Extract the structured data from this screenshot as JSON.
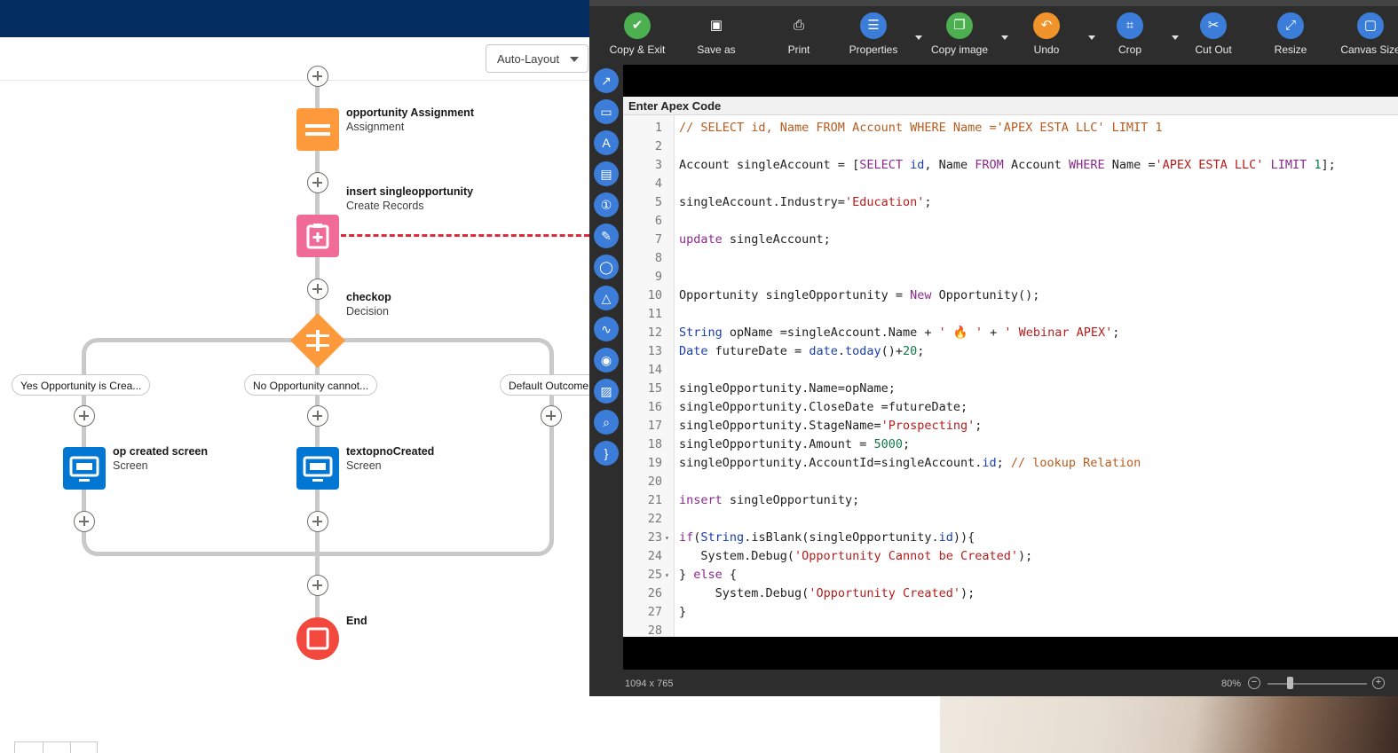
{
  "flow": {
    "auto_layout_label": "Auto-Layout",
    "nodes": {
      "assignment": {
        "title": "opportunity Assignment",
        "subtitle": "Assignment",
        "color": "#ff9a3c"
      },
      "create": {
        "title": "insert singleopportunity",
        "subtitle": "Create Records",
        "color": "#f06b97"
      },
      "decision": {
        "title": "checkop",
        "subtitle": "Decision",
        "color": "#ff9a3c"
      },
      "screen_yes": {
        "title": "op created screen",
        "subtitle": "Screen",
        "color": "#0176d3"
      },
      "screen_no": {
        "title": "textopnoCreated",
        "subtitle": "Screen",
        "color": "#0176d3"
      },
      "end": {
        "title": "End",
        "color": "#f2483d"
      }
    },
    "outcomes": {
      "yes": "Yes Opportunity is Crea...",
      "no": "No Opportunity cannot...",
      "default": "Default Outcome"
    },
    "fault_path_color": "#e0293b"
  },
  "editor": {
    "toolbar": [
      {
        "label": "Copy & Exit",
        "icon": "save-icon",
        "color": "#4caf50",
        "dropdown": false
      },
      {
        "label": "Save as",
        "icon": "floppy-icon",
        "color": "#2d2d2d",
        "dropdown": false
      },
      {
        "label": "Print",
        "icon": "printer-icon",
        "color": "#2d2d2d",
        "dropdown": false
      },
      {
        "label": "Properties",
        "icon": "list-icon",
        "color": "#3b7dd8",
        "dropdown": true
      },
      {
        "label": "Copy image",
        "icon": "copy-image-icon",
        "color": "#4caf50",
        "dropdown": true
      },
      {
        "label": "Undo",
        "icon": "undo-icon",
        "color": "#f0932b",
        "dropdown": true
      },
      {
        "label": "Crop",
        "icon": "crop-icon",
        "color": "#3b7dd8",
        "dropdown": true
      },
      {
        "label": "Cut Out",
        "icon": "cut-out-icon",
        "color": "#3b7dd8",
        "dropdown": false
      },
      {
        "label": "Resize",
        "icon": "resize-icon",
        "color": "#3b7dd8",
        "dropdown": false
      },
      {
        "label": "Canvas Size",
        "icon": "canvas-size-icon",
        "color": "#3b7dd8",
        "dropdown": false
      }
    ],
    "side_tools": [
      "arrow-icon",
      "rectangle-icon",
      "text-icon",
      "callout-icon",
      "step-icon",
      "highlighter-icon",
      "ellipse-icon",
      "blur-icon",
      "freehand-icon",
      "fill-icon",
      "image-icon",
      "magnifier-icon",
      "bracket-icon"
    ],
    "code_title": "Enter Apex Code",
    "code_lines": [
      {
        "n": "1",
        "fold": false,
        "tokens": [
          {
            "t": "// SELECT id, Name FROM Account WHERE Name ='APEX ESTA LLC' LIMIT 1",
            "c": "comment"
          }
        ]
      },
      {
        "n": "2",
        "fold": false,
        "tokens": []
      },
      {
        "n": "3",
        "fold": false,
        "tokens": [
          {
            "t": "Account singleAccount = [",
            "c": "plain"
          },
          {
            "t": "SELECT",
            "c": "keyword"
          },
          {
            "t": " ",
            "c": "plain"
          },
          {
            "t": "id",
            "c": "type"
          },
          {
            "t": ", Name ",
            "c": "plain"
          },
          {
            "t": "FROM",
            "c": "keyword"
          },
          {
            "t": " Account ",
            "c": "plain"
          },
          {
            "t": "WHERE",
            "c": "keyword"
          },
          {
            "t": " Name =",
            "c": "plain"
          },
          {
            "t": "'APEX ESTA LLC'",
            "c": "string"
          },
          {
            "t": " ",
            "c": "plain"
          },
          {
            "t": "LIMIT",
            "c": "keyword"
          },
          {
            "t": " ",
            "c": "plain"
          },
          {
            "t": "1",
            "c": "number"
          },
          {
            "t": "];",
            "c": "plain"
          }
        ]
      },
      {
        "n": "4",
        "fold": false,
        "tokens": []
      },
      {
        "n": "5",
        "fold": false,
        "tokens": [
          {
            "t": "singleAccount.Industry=",
            "c": "plain"
          },
          {
            "t": "'Education'",
            "c": "string"
          },
          {
            "t": ";",
            "c": "plain"
          }
        ]
      },
      {
        "n": "6",
        "fold": false,
        "tokens": []
      },
      {
        "n": "7",
        "fold": false,
        "tokens": [
          {
            "t": "update",
            "c": "keyword"
          },
          {
            "t": " singleAccount;",
            "c": "plain"
          }
        ]
      },
      {
        "n": "8",
        "fold": false,
        "tokens": []
      },
      {
        "n": "9",
        "fold": false,
        "tokens": []
      },
      {
        "n": "10",
        "fold": false,
        "tokens": [
          {
            "t": "Opportunity singleOpportunity = ",
            "c": "plain"
          },
          {
            "t": "New",
            "c": "keyword"
          },
          {
            "t": " Opportunity();",
            "c": "plain"
          }
        ]
      },
      {
        "n": "11",
        "fold": false,
        "tokens": []
      },
      {
        "n": "12",
        "fold": false,
        "tokens": [
          {
            "t": "String",
            "c": "type"
          },
          {
            "t": " opName =singleAccount.Name + ",
            "c": "plain"
          },
          {
            "t": "' 🔥 '",
            "c": "string"
          },
          {
            "t": " + ",
            "c": "plain"
          },
          {
            "t": "' Webinar APEX'",
            "c": "string"
          },
          {
            "t": ";",
            "c": "plain"
          }
        ]
      },
      {
        "n": "13",
        "fold": false,
        "tokens": [
          {
            "t": "Date",
            "c": "type"
          },
          {
            "t": " futureDate = ",
            "c": "plain"
          },
          {
            "t": "date",
            "c": "type"
          },
          {
            "t": ".",
            "c": "plain"
          },
          {
            "t": "today",
            "c": "type"
          },
          {
            "t": "()+",
            "c": "plain"
          },
          {
            "t": "20",
            "c": "number"
          },
          {
            "t": ";",
            "c": "plain"
          }
        ]
      },
      {
        "n": "14",
        "fold": false,
        "tokens": []
      },
      {
        "n": "15",
        "fold": false,
        "tokens": [
          {
            "t": "singleOpportunity.Name=opName;",
            "c": "plain"
          }
        ]
      },
      {
        "n": "16",
        "fold": false,
        "tokens": [
          {
            "t": "singleOpportunity.CloseDate =futureDate;",
            "c": "plain"
          }
        ]
      },
      {
        "n": "17",
        "fold": false,
        "tokens": [
          {
            "t": "singleOpportunity.StageName=",
            "c": "plain"
          },
          {
            "t": "'Prospecting'",
            "c": "string"
          },
          {
            "t": ";",
            "c": "plain"
          }
        ]
      },
      {
        "n": "18",
        "fold": false,
        "tokens": [
          {
            "t": "singleOpportunity.Amount = ",
            "c": "plain"
          },
          {
            "t": "5000",
            "c": "number"
          },
          {
            "t": ";",
            "c": "plain"
          }
        ]
      },
      {
        "n": "19",
        "fold": false,
        "tokens": [
          {
            "t": "singleOpportunity.AccountId=singleAccount.",
            "c": "plain"
          },
          {
            "t": "id",
            "c": "type"
          },
          {
            "t": "; ",
            "c": "plain"
          },
          {
            "t": "// lookup Relation",
            "c": "comment"
          }
        ]
      },
      {
        "n": "20",
        "fold": false,
        "tokens": []
      },
      {
        "n": "21",
        "fold": false,
        "tokens": [
          {
            "t": "insert",
            "c": "keyword"
          },
          {
            "t": " singleOpportunity;",
            "c": "plain"
          }
        ]
      },
      {
        "n": "22",
        "fold": false,
        "tokens": []
      },
      {
        "n": "23",
        "fold": true,
        "tokens": [
          {
            "t": "if",
            "c": "keyword"
          },
          {
            "t": "(",
            "c": "plain"
          },
          {
            "t": "String",
            "c": "type"
          },
          {
            "t": ".isBlank(singleOpportunity.",
            "c": "plain"
          },
          {
            "t": "id",
            "c": "type"
          },
          {
            "t": ")){",
            "c": "plain"
          }
        ]
      },
      {
        "n": "24",
        "fold": false,
        "tokens": [
          {
            "t": "   System.Debug(",
            "c": "plain"
          },
          {
            "t": "'Opportunity Cannot be Created'",
            "c": "string"
          },
          {
            "t": ");",
            "c": "plain"
          }
        ]
      },
      {
        "n": "25",
        "fold": true,
        "tokens": [
          {
            "t": "} ",
            "c": "plain"
          },
          {
            "t": "else",
            "c": "keyword"
          },
          {
            "t": " {",
            "c": "plain"
          }
        ]
      },
      {
        "n": "26",
        "fold": false,
        "tokens": [
          {
            "t": "     System.Debug(",
            "c": "plain"
          },
          {
            "t": "'Opportunity Created'",
            "c": "string"
          },
          {
            "t": ");",
            "c": "plain"
          }
        ]
      },
      {
        "n": "27",
        "fold": false,
        "tokens": [
          {
            "t": "}",
            "c": "plain"
          }
        ]
      },
      {
        "n": "28",
        "fold": false,
        "tokens": []
      }
    ],
    "status": {
      "dimensions": "1094 x 765",
      "zoom": "80%"
    }
  }
}
